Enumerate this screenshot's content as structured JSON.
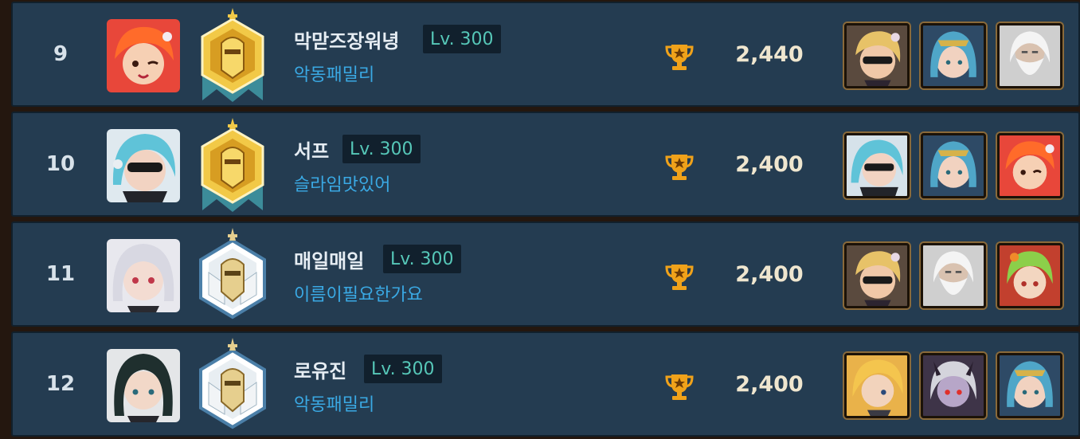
{
  "rows": [
    {
      "rank": "9",
      "name": "막맏즈장워녕",
      "level": "Lv. 300",
      "guild": "악동패밀리",
      "score": "2,440",
      "emblem": "gold",
      "avatar_icon": "orange-hair-girl-avatar",
      "heroes": [
        "sunglasses-blonde-hero-icon",
        "blue-hair-priestess-hero-icon",
        "white-bearded-sage-hero-icon"
      ]
    },
    {
      "rank": "10",
      "name": "서프",
      "level": "Lv. 300",
      "guild": "슬라임맛있어",
      "score": "2,400",
      "emblem": "gold",
      "avatar_icon": "blue-hair-sunglasses-avatar",
      "heroes": [
        "blue-hair-sunglasses-hero-icon",
        "blue-hair-priestess-hero-icon",
        "orange-hair-girl-hero-icon"
      ]
    },
    {
      "rank": "11",
      "name": "매일매일",
      "level": "Lv. 300",
      "guild": "이름이필요한가요",
      "score": "2,400",
      "emblem": "silver",
      "avatar_icon": "white-hair-girl-avatar",
      "heroes": [
        "sunglasses-blonde-hero-icon",
        "white-bearded-sage-hero-icon",
        "green-hair-elf-hero-icon"
      ]
    },
    {
      "rank": "12",
      "name": "로유진",
      "level": "Lv. 300",
      "guild": "악동패밀리",
      "score": "2,400",
      "emblem": "silver",
      "avatar_icon": "dark-hair-girl-avatar",
      "heroes": [
        "blonde-swordsman-hero-icon",
        "dark-demon-hero-icon",
        "blue-hair-priestess-hero-icon"
      ]
    }
  ],
  "colors": {
    "row_bg": "#243c51",
    "level_text": "#56c7b8",
    "guild_text": "#3aa9e4",
    "score_text": "#efe6cf",
    "trophy": "#f0a21a"
  }
}
